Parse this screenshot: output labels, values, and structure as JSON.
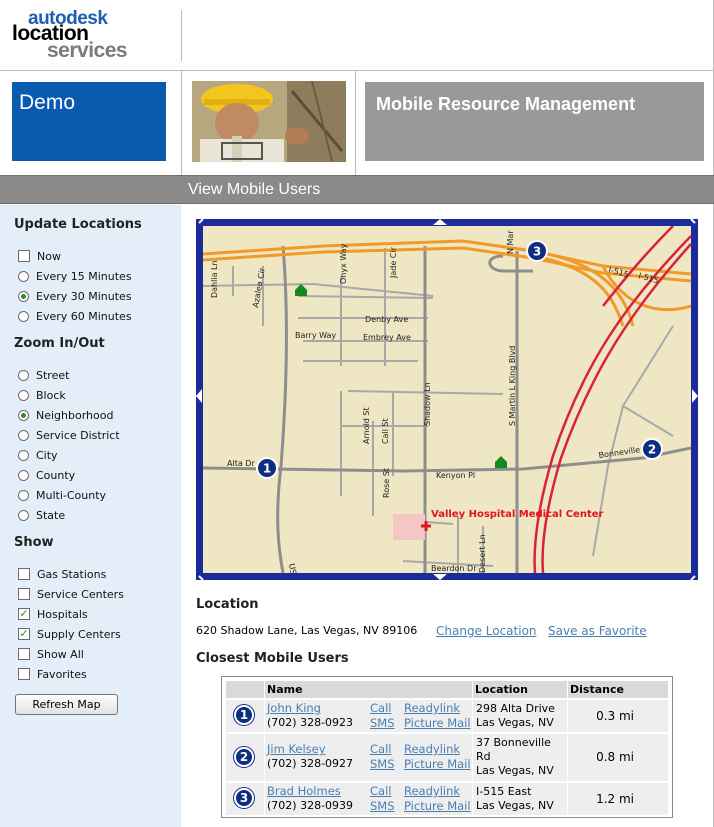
{
  "header": {
    "logo": {
      "line1": "autodesk",
      "line2": "location",
      "line3": "services"
    },
    "demo_label": "Demo",
    "title": "Mobile Resource Management",
    "band_title": "View Mobile Users"
  },
  "sidebar": {
    "update": {
      "heading": "Update Locations",
      "options": [
        {
          "label": "Now",
          "control": "checkbox",
          "checked": false
        },
        {
          "label": "Every 15 Minutes",
          "control": "radio",
          "checked": false
        },
        {
          "label": "Every 30 Minutes",
          "control": "radio",
          "checked": true
        },
        {
          "label": "Every 60 Minutes",
          "control": "radio",
          "checked": false
        }
      ]
    },
    "zoom": {
      "heading": "Zoom In/Out",
      "options": [
        {
          "label": "Street",
          "checked": false
        },
        {
          "label": "Block",
          "checked": false
        },
        {
          "label": "Neighborhood",
          "checked": true
        },
        {
          "label": "Service District",
          "checked": false
        },
        {
          "label": "City",
          "checked": false
        },
        {
          "label": "County",
          "checked": false
        },
        {
          "label": "Multi-County",
          "checked": false
        },
        {
          "label": "State",
          "checked": false
        }
      ]
    },
    "show": {
      "heading": "Show",
      "options": [
        {
          "label": "Gas Stations",
          "checked": false
        },
        {
          "label": "Service Centers",
          "checked": false
        },
        {
          "label": "Hospitals",
          "checked": true
        },
        {
          "label": "Supply Centers",
          "checked": true
        },
        {
          "label": "Show All",
          "checked": false
        },
        {
          "label": "Favorites",
          "checked": false
        }
      ]
    },
    "refresh_label": "Refresh Map"
  },
  "map": {
    "streets": [
      "Dahlia Ln",
      "Azalea Cir",
      "Onyx Way",
      "Jade Cir",
      "N Mar",
      "I-515",
      "I-515",
      "Denby Ave",
      "Barry Way",
      "Embrey Ave",
      "S Martin L King Blvd",
      "Shadow Ln",
      "Arnold St",
      "Call St",
      "Alta Dr",
      "Kenyon Pl",
      "Bonneville",
      "Rose St",
      "Beardon Dr",
      "Desert Ln",
      "US"
    ],
    "hospital_label": "Valley Hospital Medical Center",
    "markers": [
      "1",
      "2",
      "3"
    ],
    "colors": {
      "border": "#1b2b9a",
      "land": "#efe7c4",
      "freeway": "#f19a2a",
      "highway": "#d8243a",
      "road": "#9a9a9a",
      "marker": "#0d2d80",
      "hospital": "#e0141e",
      "supply": "#138a1e"
    }
  },
  "location": {
    "heading": "Location",
    "address": "620 Shadow Lane,  Las Vegas, NV 89106",
    "change_label": "Change Location",
    "save_label": "Save as Favorite"
  },
  "closest": {
    "heading": "Closest Mobile Users",
    "columns": {
      "name": "Name",
      "location": "Location",
      "distance": "Distance"
    },
    "rows": [
      {
        "num": "1",
        "name": "John King",
        "phone": "(702) 328-0923",
        "call": "Call",
        "sms": "SMS",
        "readylink": "Readylink",
        "picture_mail": "Picture Mail",
        "loc1": "298 Alta Drive",
        "loc2": "Las Vegas, NV",
        "loc3": "",
        "distance": "0.3 mi"
      },
      {
        "num": "2",
        "name": "Jim Kelsey",
        "phone": "(702) 328-0927",
        "call": "Call",
        "sms": "SMS",
        "readylink": "Readylink",
        "picture_mail": "Picture Mail",
        "loc1": "37 Bonneville",
        "loc2": "Rd",
        "loc3": "Las Vegas, NV",
        "distance": "0.8 mi"
      },
      {
        "num": "3",
        "name": "Brad Holmes",
        "phone": "(702) 328-0939",
        "call": "Call",
        "sms": "SMS",
        "readylink": "Readylink",
        "picture_mail": "Picture Mail",
        "loc1": "I-515 East",
        "loc2": "Las Vegas, NV",
        "loc3": "",
        "distance": "1.2 mi"
      }
    ]
  }
}
